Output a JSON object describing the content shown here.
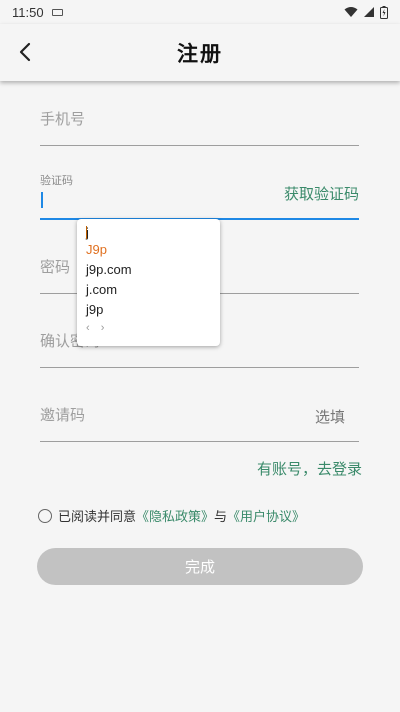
{
  "status_bar": {
    "time": "11:50"
  },
  "header": {
    "title": "注册"
  },
  "form": {
    "phone": {
      "placeholder": "手机号"
    },
    "code": {
      "label": "验证码",
      "action": "获取验证码"
    },
    "password": {
      "placeholder": "密码"
    },
    "confirm": {
      "placeholder": "确认密码"
    },
    "invite": {
      "placeholder": "邀请码",
      "optional": "选填"
    }
  },
  "login_link": "有账号，去登录",
  "agreement": {
    "prefix": "已阅读并同意",
    "privacy": "《隐私政策》",
    "and": "与",
    "terms": "《用户协议》"
  },
  "submit": {
    "label": "完成"
  },
  "suggestions": {
    "typed": "j",
    "items": [
      "J9p",
      "j9p.com",
      "j.com",
      "j9p"
    ],
    "nav": "‹ ›"
  }
}
